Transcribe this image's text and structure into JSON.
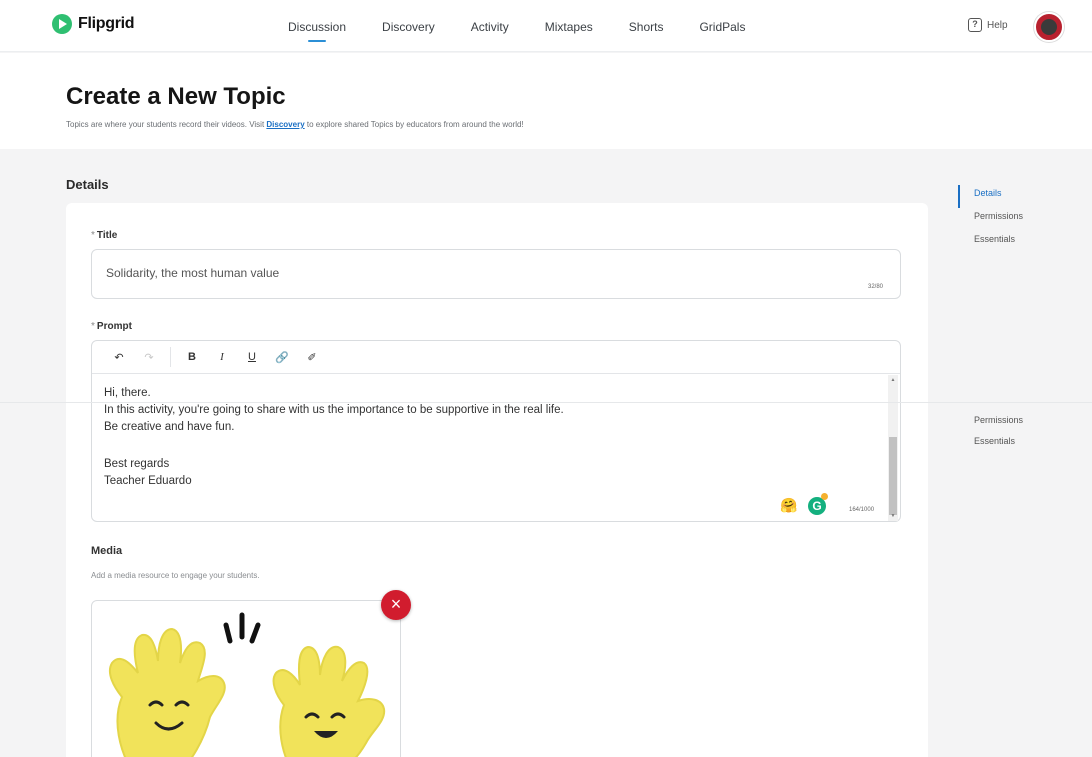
{
  "app": {
    "name": "Flipgrid"
  },
  "nav": {
    "items": [
      {
        "label": "Discussion",
        "active": true
      },
      {
        "label": "Discovery",
        "active": false
      },
      {
        "label": "Activity",
        "active": false
      },
      {
        "label": "Mixtapes",
        "active": false
      },
      {
        "label": "Shorts",
        "active": false
      },
      {
        "label": "GridPals",
        "active": false
      }
    ],
    "help_label": "Help"
  },
  "header": {
    "title": "Create a New Topic",
    "subtitle_before": "Topics are where your students record their videos. Visit ",
    "subtitle_link": "Discovery",
    "subtitle_after": " to explore shared Topics by educators from around the world!"
  },
  "details": {
    "section_label": "Details",
    "title_field": {
      "label": "Title",
      "required_mark": "*",
      "value": "Solidarity, the most human value",
      "char_count": "32/80"
    },
    "prompt_field": {
      "label": "Prompt",
      "required_mark": "*",
      "lines": [
        "Hi, there.",
        "In this activity, you're going to share with us the importance to be supportive in the real life.",
        "Be creative and have fun.",
        "",
        "Best regards",
        "Teacher Eduardo"
      ],
      "char_count": "164/1000",
      "toolbar": [
        "undo",
        "redo",
        "bold",
        "italic",
        "underline",
        "link",
        "clear-format"
      ]
    },
    "media": {
      "label": "Media",
      "description": "Add a media resource to engage your students.",
      "remove_symbol": "×"
    }
  },
  "side_nav": {
    "items": [
      {
        "label": "Details",
        "active": true
      },
      {
        "label": "Permissions",
        "active": false
      },
      {
        "label": "Essentials",
        "active": false
      }
    ],
    "repeat_items": [
      "Permissions",
      "Essentials"
    ]
  },
  "colors": {
    "accent": "#1a6fc4",
    "brand": "#2fbf71",
    "danger": "#d11c2e",
    "grammarly": "#14b07f"
  }
}
